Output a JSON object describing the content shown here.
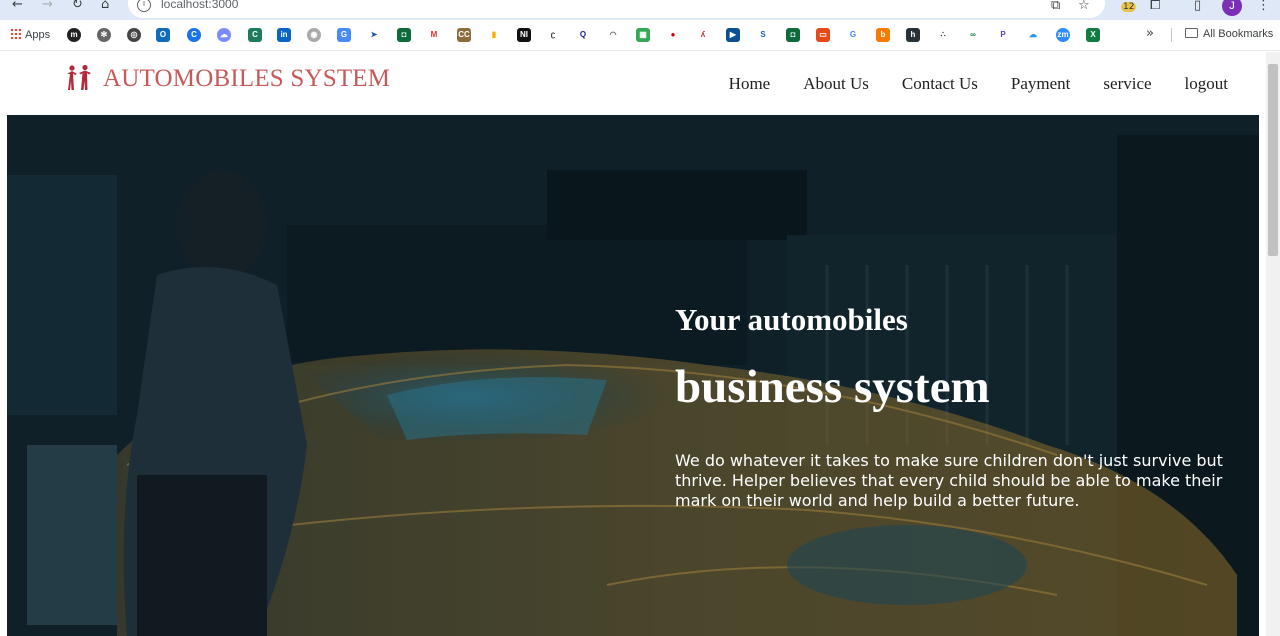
{
  "browser": {
    "url": "localhost:3000",
    "profile_initial": "J",
    "badge_count": "12",
    "bookmarks_apps_label": "Apps",
    "all_bookmarks_label": "All Bookmarks",
    "more_label": "»"
  },
  "site": {
    "logo_text": "AUTOMOBILES SYSTEM",
    "nav": [
      {
        "label": "Home"
      },
      {
        "label": "About Us"
      },
      {
        "label": "Contact Us"
      },
      {
        "label": "Payment"
      },
      {
        "label": "service"
      },
      {
        "label": "logout"
      }
    ]
  },
  "hero": {
    "line1": "Your automobiles",
    "line2": "business system",
    "text": "We do whatever it takes to make sure children don't just survive but thrive. Helper believes that every child should be able to make their mark on their world and help build a better future."
  },
  "colors": {
    "logo": "#c8595b",
    "hero_text": "#ffffff",
    "browser_bar": "#dfe8f7"
  }
}
